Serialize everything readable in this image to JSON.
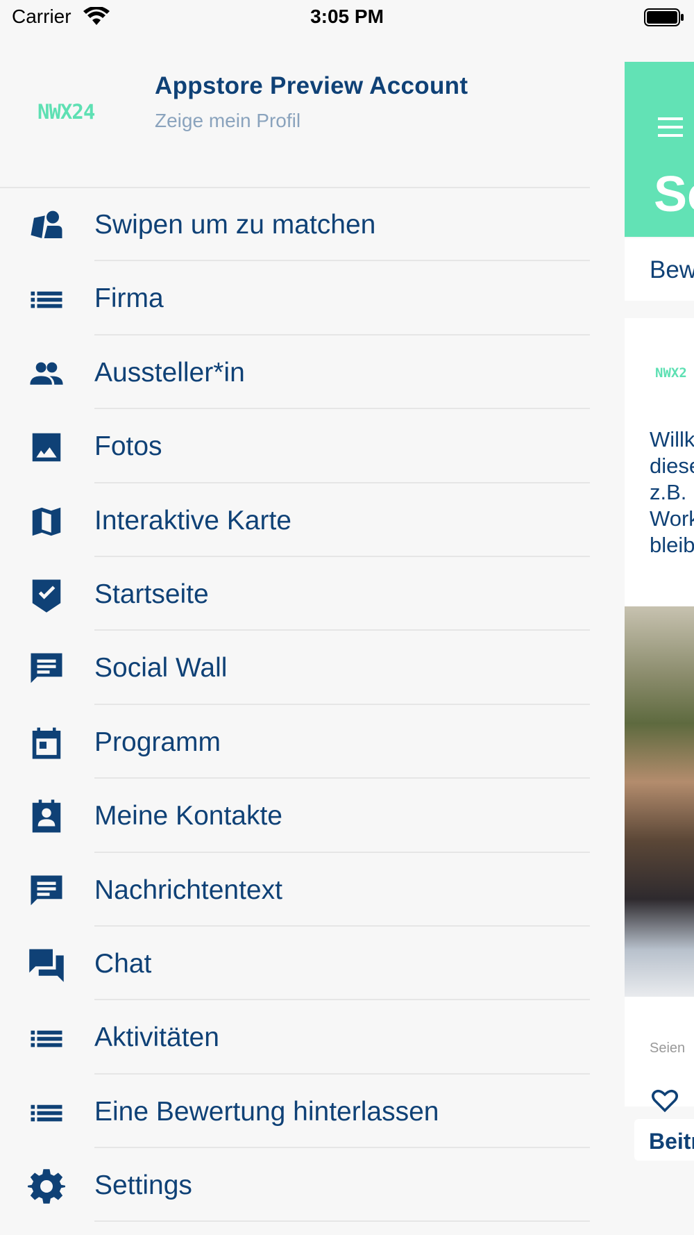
{
  "status_bar": {
    "carrier": "Carrier",
    "time": "3:05 PM",
    "wifi_icon": "wifi-icon",
    "battery_icon": "battery-icon"
  },
  "profile": {
    "logo_text": "NWX24",
    "name": "Appstore Preview Account",
    "subtitle": "Zeige mein Profil"
  },
  "menu": {
    "items": [
      {
        "label": "Swipen um zu matchen",
        "icon": "swipe-match-icon"
      },
      {
        "label": "Firma",
        "icon": "list-icon"
      },
      {
        "label": "Aussteller*in",
        "icon": "people-icon"
      },
      {
        "label": "Fotos",
        "icon": "image-icon"
      },
      {
        "label": "Interaktive Karte",
        "icon": "map-icon"
      },
      {
        "label": "Startseite",
        "icon": "checkmark-shield-icon"
      },
      {
        "label": "Social Wall",
        "icon": "message-icon"
      },
      {
        "label": "Programm",
        "icon": "calendar-icon"
      },
      {
        "label": "Meine Kontakte",
        "icon": "contact-card-icon"
      },
      {
        "label": "Nachrichtentext",
        "icon": "message-text-icon"
      },
      {
        "label": "Chat",
        "icon": "chat-bubbles-icon"
      },
      {
        "label": "Aktivitäten",
        "icon": "list-icon"
      },
      {
        "label": "Eine Bewertung hinterlassen",
        "icon": "list-icon"
      },
      {
        "label": "Settings",
        "icon": "gear-icon"
      }
    ]
  },
  "main_peek": {
    "title": "Sc",
    "tab": "Bew",
    "logo_text": "NWX2",
    "text_lines": [
      "Willk",
      "diese",
      "z.B. ",
      "Work",
      "bleib"
    ],
    "caption": "Seien",
    "button": "Beitr"
  },
  "colors": {
    "primary_text": "#0f4176",
    "accent": "#62e2b5",
    "background": "#f7f7f7"
  }
}
